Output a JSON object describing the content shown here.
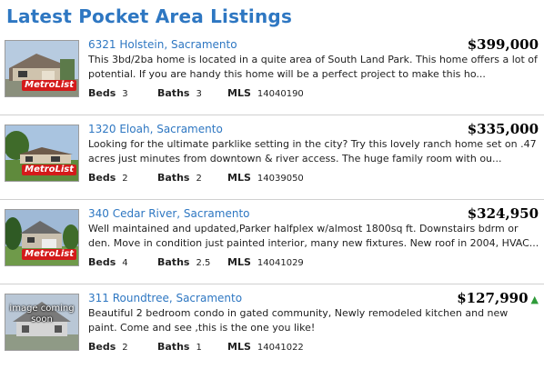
{
  "header": {
    "title": "Latest Pocket Area Listings"
  },
  "labels": {
    "beds": "Beds",
    "baths": "Baths",
    "mls": "MLS"
  },
  "colors": {
    "accent": "#2e77c2",
    "price_up": "#2f9b3a",
    "metrolist": "#d41a1a"
  },
  "listings": [
    {
      "address": "6321 Holstein, Sacramento",
      "price": "$399,000",
      "description": "This 3bd/2ba home is located in a quite area of South Land Park. This home offers a lot of potential. If you are handy this home will be a perfect project to make this ho...",
      "beds": "3",
      "baths": "3",
      "mls": "14040190",
      "logo": "MetroList",
      "price_trend": ""
    },
    {
      "address": "1320 Eloah, Sacramento",
      "price": "$335,000",
      "description": "Looking for the ultimate parklike setting in the city? Try this lovely ranch home set on .47 acres just minutes from downtown & river access. The huge family room with ou...",
      "beds": "2",
      "baths": "2",
      "mls": "14039050",
      "logo": "MetroList",
      "price_trend": ""
    },
    {
      "address": "340 Cedar River, Sacramento",
      "price": "$324,950",
      "description": "Well maintained and updated,Parker halfplex w/almost 1800sq ft. Downstairs bdrm or den. Move in condition just painted interior, many new fixtures. New roof in 2004, HVAC...",
      "beds": "4",
      "baths": "2.5",
      "mls": "14041029",
      "logo": "MetroList",
      "price_trend": ""
    },
    {
      "address": "311 Roundtree, Sacramento",
      "price": "$127,990",
      "description": "Beautiful 2 bedroom condo in gated community, Newly remodeled kitchen and new paint. Come and see ,this is the one you like!",
      "beds": "2",
      "baths": "1",
      "mls": "14041022",
      "image_caption": "image coming soon",
      "price_trend": "▲"
    }
  ]
}
